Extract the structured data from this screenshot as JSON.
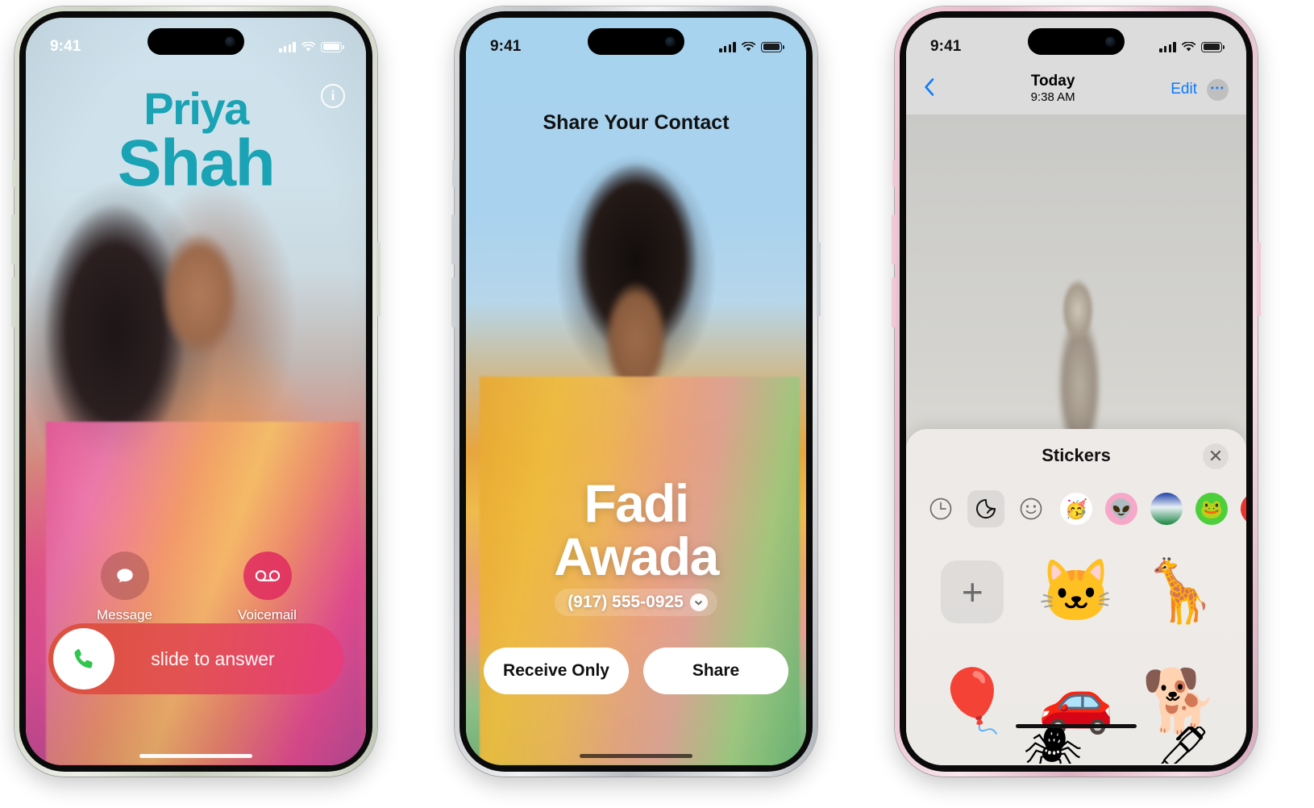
{
  "scene": {
    "description": "Three iPhone screenshots side by side showing iOS Contact Poster, NameDrop, and Stickers features",
    "phone_count": 3
  },
  "phone1": {
    "device_name": "iPhone 15 Pro",
    "bezel_color": "#cdd4c4",
    "status": {
      "time": "9:41",
      "cellular_icon": "signal-bars-icon",
      "wifi_icon": "wifi-icon",
      "battery_icon": "battery-icon"
    },
    "info_button": {
      "icon": "info-icon",
      "glyph": "i"
    },
    "caller": {
      "first_name": "Priya",
      "last_name": "Shah",
      "name_color": "#19a3b4"
    },
    "actions": [
      {
        "label": "Message",
        "icon": "message-bubble-icon",
        "glyph": "💬",
        "color": "#a85454"
      },
      {
        "label": "Voicemail",
        "icon": "voicemail-icon",
        "glyph": "⊙⊙",
        "color": "#e02c60"
      }
    ],
    "slider": {
      "label": "slide to answer",
      "icon": "phone-handset-icon",
      "accent": "#db4f38"
    }
  },
  "phone2": {
    "device_name": "iPhone 15 Pro",
    "bezel_color": "#c2c5c9",
    "status": {
      "time": "9:41",
      "cellular_icon": "signal-bars-icon",
      "wifi_icon": "wifi-icon",
      "battery_icon": "battery-icon"
    },
    "title": "Share Your Contact",
    "contact": {
      "first_name": "Fadi",
      "last_name": "Awada",
      "phone": "(917) 555-0925",
      "phone_chevron_icon": "chevron-down-icon"
    },
    "buttons": [
      {
        "label": "Receive Only",
        "name": "receive-only-button"
      },
      {
        "label": "Share",
        "name": "share-button"
      }
    ]
  },
  "phone3": {
    "device_name": "iPhone 15",
    "bezel_color": "#e6bdcb",
    "status": {
      "time": "9:41",
      "cellular_icon": "signal-bars-icon",
      "wifi_icon": "wifi-icon",
      "battery_icon": "battery-icon"
    },
    "nav": {
      "back_icon": "chevron-left-icon",
      "title": "Today",
      "subtitle": "9:38 AM",
      "edit_label": "Edit",
      "more_icon": "ellipsis-circle-icon",
      "more_glyph": "⋯"
    },
    "photo": {
      "subject": "cat sitting on leather ottoman"
    },
    "stickers_panel": {
      "title": "Stickers",
      "close_icon": "close-icon",
      "close_glyph": "✕",
      "categories": [
        {
          "name": "recents",
          "icon": "clock-icon",
          "glyph": "🕓",
          "selected": false
        },
        {
          "name": "stickers",
          "icon": "sticker-peel-icon",
          "glyph": "◗",
          "selected": true
        },
        {
          "name": "emoji",
          "icon": "smiley-icon",
          "glyph": "🙂",
          "selected": false
        },
        {
          "name": "memoji",
          "icon": "memoji-icon",
          "glyph": "🥳",
          "selected": false
        },
        {
          "name": "sticker-pack-alien",
          "icon": "alien-sticker-pack-icon",
          "glyph": "👽",
          "selected": false
        },
        {
          "name": "sticker-pack-landscape",
          "icon": "landscape-sticker-pack-icon",
          "glyph": "🏞",
          "selected": false
        },
        {
          "name": "sticker-pack-owl",
          "icon": "owl-sticker-pack-icon",
          "glyph": "🐸",
          "selected": false
        },
        {
          "name": "sticker-pack-red",
          "icon": "red-sticker-pack-icon",
          "glyph": "🍅",
          "selected": false
        }
      ],
      "items": [
        {
          "name": "add-sticker",
          "icon": "plus-icon",
          "glyph": "+",
          "is_add": true
        },
        {
          "name": "cat-sticker",
          "icon": "cat-sticker-icon",
          "glyph": "🐱",
          "is_add": false
        },
        {
          "name": "giraffe-sticker",
          "icon": "giraffe-sticker-icon",
          "glyph": "🦒",
          "is_add": false
        },
        {
          "name": "hot-air-balloon-sticker",
          "icon": "balloon-sticker-icon",
          "glyph": "🎈",
          "is_add": false
        },
        {
          "name": "red-car-sticker",
          "icon": "car-sticker-icon",
          "glyph": "🚗",
          "is_add": false
        },
        {
          "name": "dog-sunglasses-sticker",
          "icon": "dog-sticker-icon",
          "glyph": "🐕",
          "is_add": false
        }
      ],
      "peek_items": [
        {
          "name": "spider-sticker",
          "glyph": "🕷"
        },
        {
          "name": "pen-sticker",
          "glyph": "🖊"
        }
      ]
    }
  }
}
